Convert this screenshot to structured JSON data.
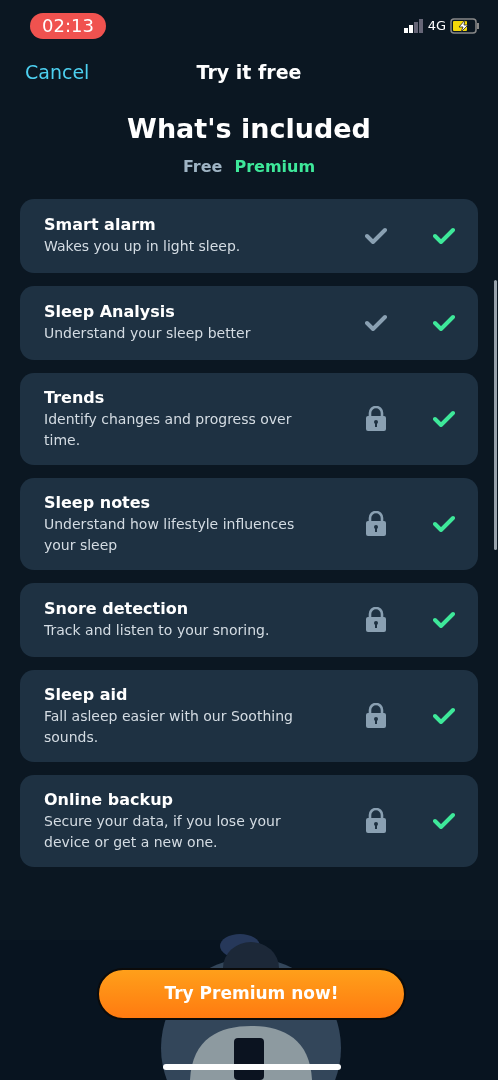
{
  "status_bar": {
    "time": "02:13",
    "network": "4G"
  },
  "header": {
    "cancel": "Cancel",
    "title": "Try it free"
  },
  "heading": "What's included",
  "columns": [
    "Free",
    "Premium"
  ],
  "features": [
    {
      "title": "Smart alarm",
      "description": "Wakes you up in light sleep.",
      "free_locked": false
    },
    {
      "title": "Sleep Analysis",
      "description": "Understand your sleep better",
      "free_locked": false
    },
    {
      "title": "Trends",
      "description": "Identify changes and progress over time.",
      "free_locked": true
    },
    {
      "title": "Sleep notes",
      "description": "Understand how lifestyle influences your sleep",
      "free_locked": true
    },
    {
      "title": "Snore detection",
      "description": "Track and listen to your snoring.",
      "free_locked": true
    },
    {
      "title": "Sleep aid",
      "description": "Fall asleep easier with our Soothing sounds.",
      "free_locked": true
    },
    {
      "title": "Online backup",
      "description": "Secure your data, if you lose your device or get a new one.",
      "free_locked": true
    }
  ],
  "cta": "Try Premium now!"
}
